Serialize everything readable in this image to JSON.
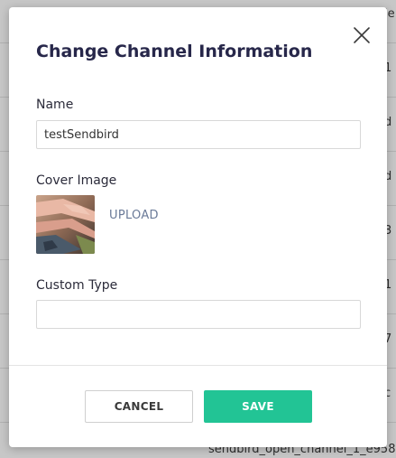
{
  "background": {
    "row_fragments": [
      "le",
      "1",
      "d",
      "d",
      "3",
      "1",
      "7",
      "c"
    ],
    "last_row_text": "sendbird_open_channel_1_e958"
  },
  "modal": {
    "title": "Change Channel Information",
    "name": {
      "label": "Name",
      "value": "testSendbird"
    },
    "cover_image": {
      "label": "Cover Image",
      "upload_label": "UPLOAD"
    },
    "custom_type": {
      "label": "Custom Type",
      "value": "",
      "placeholder": ""
    },
    "buttons": {
      "cancel": "CANCEL",
      "save": "SAVE"
    }
  },
  "colors": {
    "accent": "#22c495",
    "title": "#27274a",
    "upload_link": "#6a7a98"
  },
  "icons": {
    "close": "close-icon"
  }
}
